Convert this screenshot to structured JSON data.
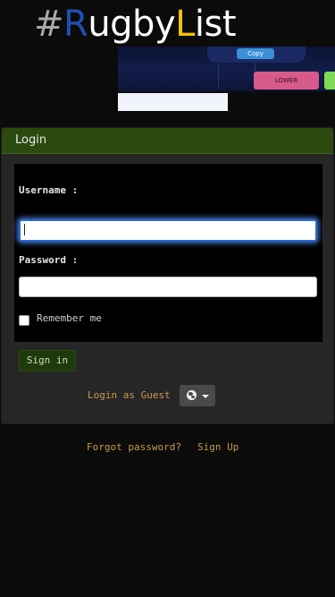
{
  "logo": {
    "parts": [
      {
        "text": "#",
        "color": "#a9a9a9"
      },
      {
        "text": "R",
        "color": "#1f4fb4"
      },
      {
        "text": "ugby",
        "color": "#ffffff"
      },
      {
        "text": "L",
        "color": "#f2c300"
      },
      {
        "text": "ist",
        "color": "#ffffff"
      }
    ]
  },
  "banner": {
    "copy_label": "Copy",
    "lower_label": "LOWER"
  },
  "login": {
    "title": "Login",
    "username_label": "Username :",
    "username_value": "",
    "password_label": "Password :",
    "password_value": "",
    "remember_label": "Remember me",
    "remember_checked": false,
    "signin_label": "Sign in",
    "guest_label": "Login as Guest"
  },
  "footer": {
    "forgot_label": "Forgot password?",
    "signup_label": "Sign Up"
  },
  "colors": {
    "header_bg": "#2a4a0f",
    "link": "#c89b4b",
    "focus_ring": "#2a68d6"
  }
}
